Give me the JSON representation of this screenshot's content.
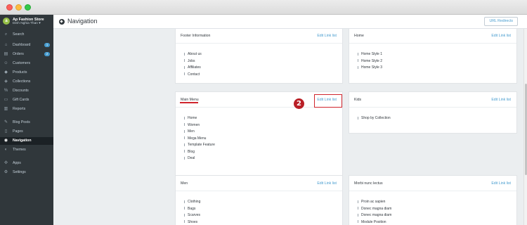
{
  "store": {
    "initial": "a",
    "name": "Ap Fashion Store",
    "user": "Dinh Nghia Than"
  },
  "sidebar": {
    "items": [
      {
        "label": "Search",
        "icon": "search-icon"
      },
      {
        "label": "Dashboard",
        "icon": "home-icon",
        "badge": "1"
      },
      {
        "label": "Orders",
        "icon": "orders-icon",
        "badge": "2"
      },
      {
        "label": "Customers",
        "icon": "customers-icon"
      },
      {
        "label": "Products",
        "icon": "tag-icon"
      },
      {
        "label": "Collections",
        "icon": "collections-icon"
      },
      {
        "label": "Discounts",
        "icon": "discount-icon"
      },
      {
        "label": "Gift Cards",
        "icon": "gift-card-icon"
      },
      {
        "label": "Reports",
        "icon": "reports-icon"
      },
      {
        "label": "Blog Posts",
        "icon": "blog-icon"
      },
      {
        "label": "Pages",
        "icon": "pages-icon"
      },
      {
        "label": "Navigation",
        "icon": "navigation-icon",
        "active": true
      },
      {
        "label": "Themes",
        "icon": "themes-icon"
      },
      {
        "label": "Apps",
        "icon": "apps-icon"
      },
      {
        "label": "Settings",
        "icon": "settings-icon"
      }
    ]
  },
  "header": {
    "title": "Navigation",
    "url_redirects_label": "URL Redirects"
  },
  "menus": [
    {
      "title": "Footer Information",
      "edit_label": "Edit Link list",
      "items": [
        "About us",
        "Jobs",
        "Affiliates",
        "Contact"
      ]
    },
    {
      "title": "Home",
      "edit_label": "Edit Link list",
      "items": [
        "Home Style 1",
        "Home Style 2",
        "Home Style 3"
      ]
    },
    {
      "title": "Main Menu",
      "edit_label": "Edit Link list",
      "items": [
        "Home",
        "Women",
        "Men",
        "Mega Menu",
        "Template Feature",
        "Blog",
        "Deal"
      ]
    },
    {
      "title": "Kids",
      "edit_label": "Edit Link list",
      "items": [
        "Shop by Collection"
      ]
    },
    {
      "title": "Men",
      "edit_label": "Edit Link list",
      "items": [
        "Clothing",
        "Bags",
        "Scarves",
        "Shoes"
      ]
    },
    {
      "title": "Morbi nunc lectus",
      "edit_label": "Edit Link list",
      "items": [
        "Proin ac sapien",
        "Donec magna diam",
        "Donec magna diam",
        "Module Position"
      ]
    }
  ],
  "annotation": {
    "step_number": "2",
    "color": "#d0252d"
  },
  "colors": {
    "sidebar_bg": "#30373b",
    "link": "#479ccf",
    "brand": "#95bf47"
  }
}
